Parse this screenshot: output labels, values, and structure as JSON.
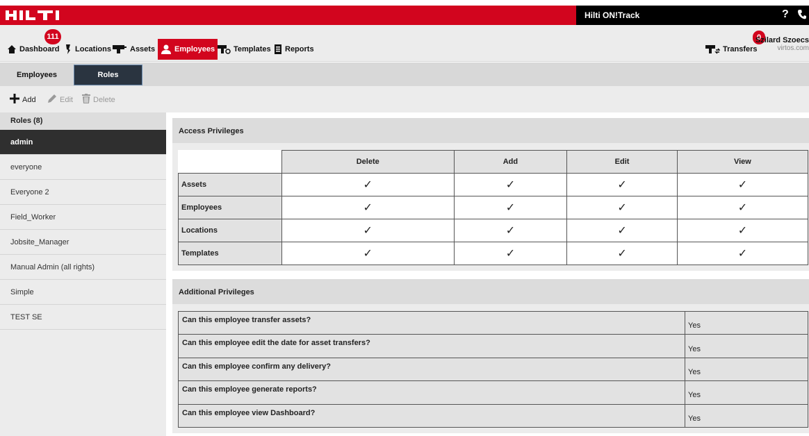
{
  "app": {
    "logo_text": "HILTI",
    "product_name": "Hilti ON!Track",
    "help_label": "?"
  },
  "nav": {
    "dashboard": {
      "label": "Dashboard",
      "badge": "111"
    },
    "locations": {
      "label": "Locations"
    },
    "assets": {
      "label": "Assets"
    },
    "employees": {
      "label": "Employees"
    },
    "templates": {
      "label": "Templates"
    },
    "reports": {
      "label": "Reports"
    },
    "transfers": {
      "label": "Transfers",
      "badge": "0"
    },
    "user": {
      "name": "Szilard Szoecs",
      "domain": "virtos.com"
    }
  },
  "subtabs": {
    "employees": "Employees",
    "roles": "Roles"
  },
  "toolbar": {
    "add": "Add",
    "edit": "Edit",
    "delete": "Delete"
  },
  "roles": {
    "header": "Roles (8)",
    "items": [
      "admin",
      "everyone",
      "Everyone 2",
      "Field_Worker",
      "Jobsite_Manager",
      "Manual Admin (all rights)",
      "Simple",
      "TEST SE"
    ],
    "selected": "admin"
  },
  "access": {
    "title": "Access Privileges",
    "columns": [
      "Delete",
      "Add",
      "Edit",
      "View"
    ],
    "rows": [
      {
        "label": "Assets",
        "values": [
          "✓",
          "✓",
          "✓",
          "✓"
        ]
      },
      {
        "label": "Employees",
        "values": [
          "✓",
          "✓",
          "✓",
          "✓"
        ]
      },
      {
        "label": "Locations",
        "values": [
          "✓",
          "✓",
          "✓",
          "✓"
        ]
      },
      {
        "label": "Templates",
        "values": [
          "✓",
          "✓",
          "✓",
          "✓"
        ]
      }
    ]
  },
  "additional": {
    "title": "Additional Privileges",
    "rows": [
      {
        "question": "Can this employee transfer assets?",
        "answer": "Yes"
      },
      {
        "question": "Can this employee edit the date for asset transfers?",
        "answer": "Yes"
      },
      {
        "question": "Can this employee confirm any delivery?",
        "answer": "Yes"
      },
      {
        "question": "Can this employee generate reports?",
        "answer": "Yes"
      },
      {
        "question": "Can this employee view Dashboard?",
        "answer": "Yes"
      }
    ]
  },
  "colors": {
    "brand_red": "#d2051e",
    "dark": "#2f2f2f",
    "black": "#000000"
  }
}
